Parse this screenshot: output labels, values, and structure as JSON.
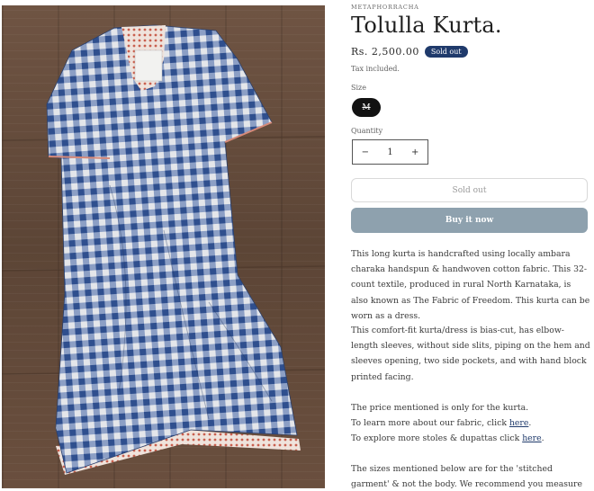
{
  "product": {
    "vendor": "METAPHORRACHA",
    "title": "Tolulla Kurta.",
    "price": "Rs. 2,500.00",
    "badge": "Sold out",
    "tax_note": "Tax included."
  },
  "size": {
    "label": "Size",
    "selected": "M"
  },
  "quantity": {
    "label": "Quantity",
    "value": "1",
    "minus": "−",
    "plus": "+"
  },
  "buttons": {
    "sold_out": "Sold out",
    "buy_now": "Buy it now"
  },
  "description": {
    "para1": "This long kurta is handcrafted using locally ambara charaka handspun & handwoven cotton fabric. This 32-count textile, produced in rural North Karnataka, is also known as The Fabric of Freedom. This kurta can be worn as a dress.",
    "para2": "This comfort-fit kurta/dress is bias-cut, has elbow-length sleeves, without side slits, piping on the hem and sleeves opening, two side pockets, and with hand block printed facing.",
    "price_note": "The price mentioned is only for the kurta.",
    "fabric_line_prefix": "To learn more about our fabric, click ",
    "fabric_link": "here",
    "fabric_line_suffix": ".",
    "stoles_line_prefix": "To explore more stoles & dupattas click ",
    "stoles_link": "here",
    "stoles_line_suffix": ".",
    "para4": "The sizes mentioned below are for the 'stitched garment' & not the body. We recommend you measure one of your"
  },
  "colors": {
    "badge": "#1f3a6b",
    "buy_button": "#8ea1ae",
    "size_selected": "#121212",
    "gingham_blue": "#3b5c9a",
    "gingham_light": "#d9dde6",
    "wood": "#6f5443"
  }
}
